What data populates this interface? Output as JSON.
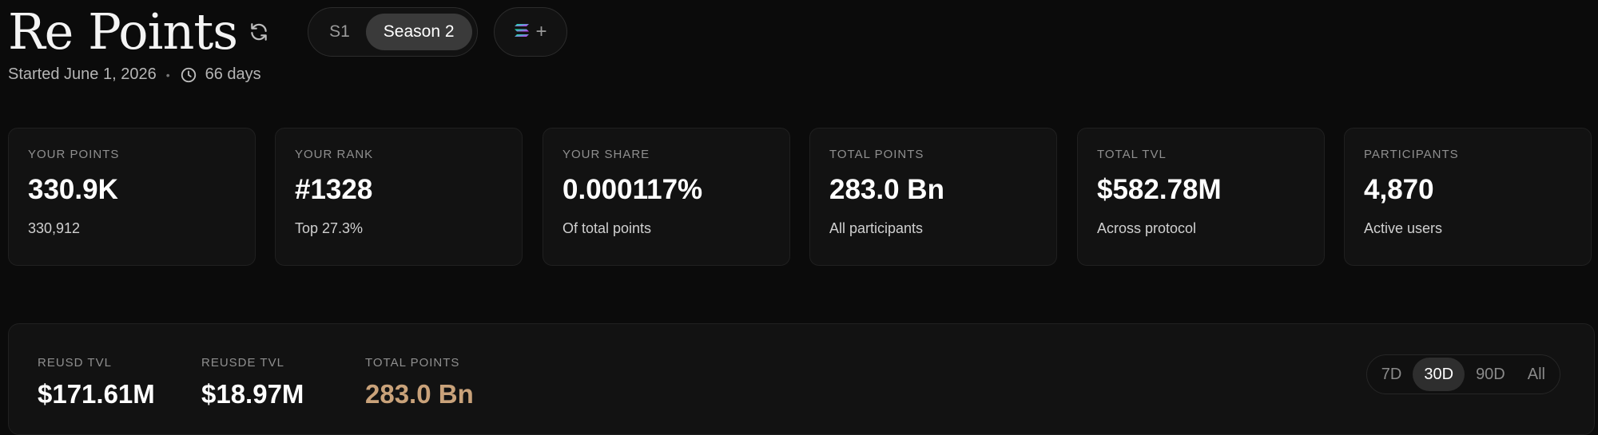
{
  "header": {
    "title": "Re Points",
    "seasons": [
      "S1",
      "Season 2"
    ],
    "active_season": "Season 2",
    "chain_plus": "+",
    "started": "Started June 1, 2026",
    "separator": "•",
    "duration": "66 days"
  },
  "stats": [
    {
      "label": "YOUR POINTS",
      "value": "330.9K",
      "sub": "330,912"
    },
    {
      "label": "YOUR RANK",
      "value": "#1328",
      "sub": "Top 27.3%"
    },
    {
      "label": "YOUR SHARE",
      "value": "0.000117%",
      "sub": "Of total points"
    },
    {
      "label": "TOTAL POINTS",
      "value": "283.0 Bn",
      "sub": "All participants"
    },
    {
      "label": "TOTAL TVL",
      "value": "$582.78M",
      "sub": "Across protocol"
    },
    {
      "label": "PARTICIPANTS",
      "value": "4,870",
      "sub": "Active users"
    }
  ],
  "tvl_panel": {
    "items": [
      {
        "label": "REUSD TVL",
        "value": "$171.61M"
      },
      {
        "label": "REUSDE TVL",
        "value": "$18.97M"
      },
      {
        "label": "TOTAL POINTS",
        "value": "283.0 Bn"
      }
    ],
    "ranges": [
      "7D",
      "30D",
      "90D",
      "All"
    ],
    "active_range": "30D"
  },
  "colors": {
    "background": "#0b0b0b",
    "card": "#121212",
    "accent_points": "#c9a27a"
  },
  "icons": {
    "refresh": "refresh-icon",
    "clock": "clock-icon",
    "chain": "solana-logo-icon"
  }
}
